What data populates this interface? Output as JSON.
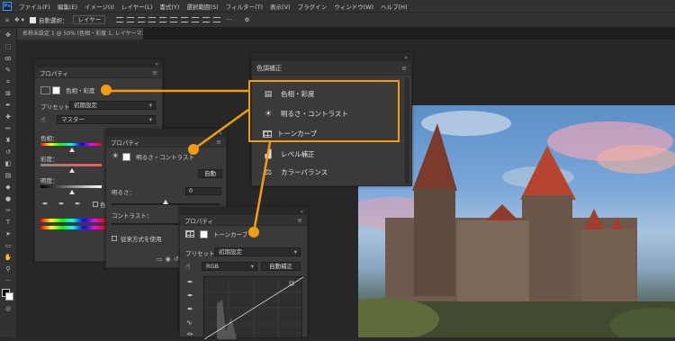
{
  "app": {
    "logo": "Ps"
  },
  "menubar": [
    "ファイル(F)",
    "編集(E)",
    "イメージ(I)",
    "レイヤー(L)",
    "書式(Y)",
    "選択範囲(S)",
    "フィルター(T)",
    "表示(V)",
    "プラグイン",
    "ウィンドウ(W)",
    "ヘルプ(H)"
  ],
  "options": {
    "auto_select_label": "自動選択：",
    "auto_select_value": "レイヤー"
  },
  "document": {
    "tab_title": "名称未設定 1 @ 50% (色相・彩度 1, レイヤーマスク/8) *"
  },
  "panel_hue": {
    "title": "プロパティ",
    "layer_label": "色相・彩度",
    "preset_label": "プリセット：",
    "preset_value": "初期設定",
    "channel_value": "マスター",
    "hue_label": "色相：",
    "sat_label": "彩度：",
    "light_label": "明度：",
    "colorize_label": "色"
  },
  "panel_brightness": {
    "title": "プロパティ",
    "layer_label": "明るさ・コントラスト",
    "auto_button": "自動",
    "brightness_label": "明るさ：",
    "brightness_value": "0",
    "contrast_label": "コントラスト：",
    "legacy_label": "従来方式を使用"
  },
  "panel_curves": {
    "title": "プロパティ",
    "layer_label": "トーンカーブ",
    "preset_label": "プリセット：",
    "preset_value": "初期設定",
    "channel_value": "RGB",
    "auto_button": "自動補正"
  },
  "adjustments": {
    "title": "色調補正",
    "items": [
      "色相・彩度",
      "明るさ・コントラスト",
      "トーンカーブ",
      "レベル補正",
      "カラーバランス"
    ]
  },
  "colors": {
    "accent": "#f39c12",
    "panel": "#3a3a3a",
    "bg": "#2b2b2b"
  }
}
